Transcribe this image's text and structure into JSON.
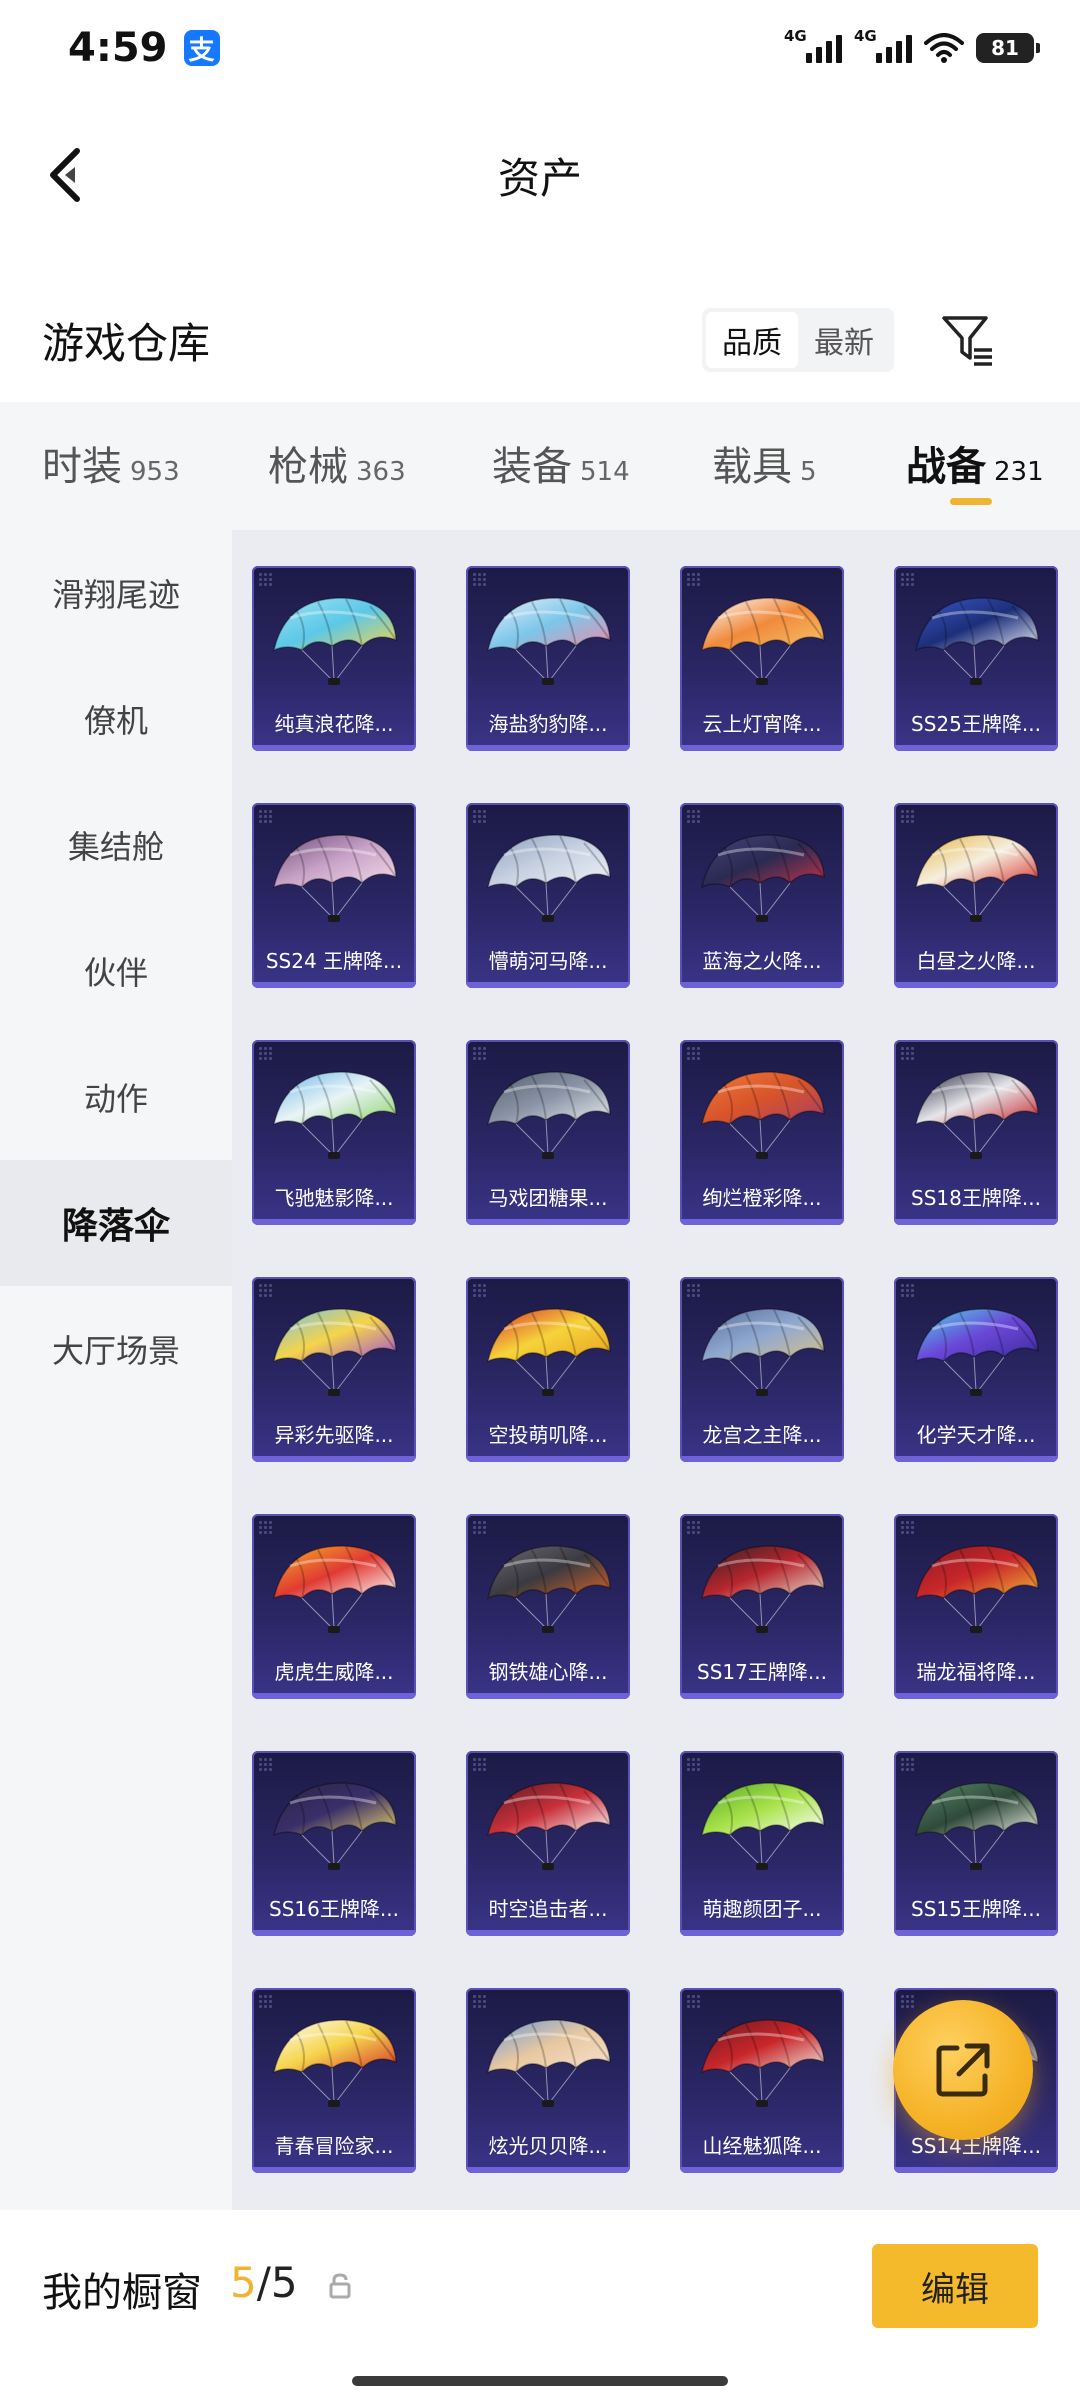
{
  "status_bar": {
    "time": "4:59",
    "alipay_glyph": "支",
    "network_1": "4G",
    "network_2": "4G",
    "battery": "81"
  },
  "header": {
    "title": "资产"
  },
  "warehouse": {
    "title": "游戏仓库",
    "sort_options": [
      "品质",
      "最新"
    ],
    "active_sort": "品质"
  },
  "tabs": [
    {
      "label": "时装",
      "count": "953"
    },
    {
      "label": "枪械",
      "count": "363"
    },
    {
      "label": "装备",
      "count": "514"
    },
    {
      "label": "载具",
      "count": "5"
    },
    {
      "label": "战备",
      "count": "231",
      "active": true
    }
  ],
  "sidebar": {
    "items": [
      "滑翔尾迹",
      "僚机",
      "集结舱",
      "伙伴",
      "动作",
      "降落伞",
      "大厅场景"
    ],
    "active": "降落伞"
  },
  "items": [
    {
      "name": "纯真浪花降...",
      "colors": [
        "#5cc8e8",
        "#f5d44a",
        "#9fe3f0"
      ]
    },
    {
      "name": "海盐豹豹降...",
      "colors": [
        "#7cc6ea",
        "#f08aa8",
        "#e9f1fb"
      ]
    },
    {
      "name": "云上灯宵降...",
      "colors": [
        "#f08a3c",
        "#f8c46a",
        "#ffffff"
      ]
    },
    {
      "name": "SS25王牌降...",
      "colors": [
        "#1d2f7a",
        "#e8ecf6",
        "#3a58c8"
      ]
    },
    {
      "name": "SS24 王牌降...",
      "colors": [
        "#c9a3c8",
        "#f3dbe8",
        "#6e4f79"
      ]
    },
    {
      "name": "懵萌河马降...",
      "colors": [
        "#c8d2e2",
        "#eef2f8",
        "#8fa0bf"
      ]
    },
    {
      "name": "蓝海之火降...",
      "colors": [
        "#2b2a52",
        "#c7344a",
        "#45437a"
      ]
    },
    {
      "name": "白昼之火降...",
      "colors": [
        "#f5efe0",
        "#d8332f",
        "#e8b640"
      ]
    },
    {
      "name": "飞驰魅影降...",
      "colors": [
        "#e8f4f6",
        "#8fd36a",
        "#6fb8e8"
      ]
    },
    {
      "name": "马戏团糖果...",
      "colors": [
        "#8a94a6",
        "#e8ecf0",
        "#55606f"
      ]
    },
    {
      "name": "绚烂橙彩降...",
      "colors": [
        "#d8542a",
        "#a63f66",
        "#f07a3a"
      ]
    },
    {
      "name": "SS18王牌降...",
      "colors": [
        "#e6e6ea",
        "#c8242c",
        "#2a2a44"
      ]
    },
    {
      "name": "异彩先驱降...",
      "colors": [
        "#f5d44a",
        "#9e4fd8",
        "#74c2e8"
      ]
    },
    {
      "name": "空投萌叽降...",
      "colors": [
        "#f6d33a",
        "#e8a020",
        "#d8332f"
      ]
    },
    {
      "name": "龙宫之主降...",
      "colors": [
        "#8fa8d0",
        "#d8c28a",
        "#5a6f9a"
      ]
    },
    {
      "name": "化学天才降...",
      "colors": [
        "#6a48d8",
        "#3b2b9a",
        "#4fd8e8"
      ]
    },
    {
      "name": "虎虎生威降...",
      "colors": [
        "#e03a32",
        "#ffffff",
        "#f5b327"
      ]
    },
    {
      "name": "钢铁雄心降...",
      "colors": [
        "#3a3a40",
        "#d8642a",
        "#6a6a70"
      ]
    },
    {
      "name": "SS17王牌降...",
      "colors": [
        "#b8262e",
        "#e6e0d0",
        "#2a2224"
      ]
    },
    {
      "name": "瑞龙福将降...",
      "colors": [
        "#c8262a",
        "#f0b433",
        "#8a1c22"
      ]
    },
    {
      "name": "SS16王牌降...",
      "colors": [
        "#3a2f6a",
        "#e8d26a",
        "#2a2444"
      ]
    },
    {
      "name": "时空追击者...",
      "colors": [
        "#c8303a",
        "#ffffff",
        "#5a1a24"
      ]
    },
    {
      "name": "萌趣颜团子...",
      "colors": [
        "#a8e24a",
        "#ffffff",
        "#5aa82a"
      ]
    },
    {
      "name": "SS15王牌降...",
      "colors": [
        "#2f4a3a",
        "#e8ece0",
        "#5a8a6a"
      ]
    },
    {
      "name": "青春冒险家...",
      "colors": [
        "#f5d44a",
        "#d8332f",
        "#ffffff"
      ]
    },
    {
      "name": "炫光贝贝降...",
      "colors": [
        "#e8c8a0",
        "#f6e2d0",
        "#6a9ad8"
      ]
    },
    {
      "name": "山经魅狐降...",
      "colors": [
        "#c8262a",
        "#f0e8e0",
        "#6a1a22"
      ]
    },
    {
      "name": "SS14王牌降...",
      "colors": [
        "#3a3a70",
        "#c8c8e0",
        "#2a2a50"
      ]
    }
  ],
  "bottom_bar": {
    "showcase_label": "我的橱窗",
    "showcase_current": "5",
    "showcase_total": "/5",
    "edit_label": "编辑"
  },
  "colors": {
    "accent": "#f0b433",
    "card_bg": "#2a2664",
    "card_border": "#5b50b8"
  }
}
